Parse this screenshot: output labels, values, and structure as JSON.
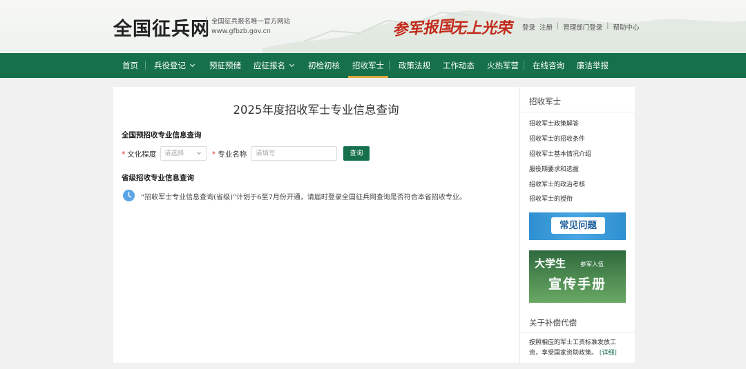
{
  "header": {
    "logo": "全国征兵网",
    "subtitle_line1": "全国征兵报名唯一官方网站",
    "subtitle_line2": "www.gfbzb.gov.cn",
    "slogan1": "参军报国",
    "slogan2": "无上光荣",
    "links": {
      "login": "登录",
      "register": "注册",
      "admin_login": "管理部门登录",
      "help": "帮助中心",
      "separator": "|"
    }
  },
  "nav": {
    "items": [
      {
        "label": "首页",
        "dropdown": false
      },
      {
        "label": "兵役登记",
        "dropdown": true
      },
      {
        "label": "预征预储",
        "dropdown": false
      },
      {
        "label": "应征报名",
        "dropdown": true
      },
      {
        "label": "初检初核",
        "dropdown": false
      },
      {
        "label": "招收军士",
        "dropdown": false,
        "active": true
      },
      {
        "label": "政策法规",
        "dropdown": false
      },
      {
        "label": "工作动态",
        "dropdown": false
      },
      {
        "label": "火热军营",
        "dropdown": false
      },
      {
        "label": "在线咨询",
        "dropdown": false
      },
      {
        "label": "廉洁举报",
        "dropdown": false
      }
    ]
  },
  "main": {
    "title": "2025年度招收军士专业信息查询",
    "national_section": "全国预招收专业信息查询",
    "required_mark": "*",
    "education_label": "文化程度",
    "education_placeholder": "请选择",
    "major_label": "专业名称",
    "major_placeholder": "请填写",
    "query_button": "查询",
    "provincial_section": "省级招收专业信息查询",
    "notice": "“招收军士专业信息查询(省级)”计划于6至7月份开通，请届时登录全国征兵网查询是否符合本省招收专业。"
  },
  "sidebar": {
    "heading": "招收军士",
    "links": [
      "招收军士政策解答",
      "招收军士的招收条件",
      "招收军士基本情况介绍",
      "服役期要求和选拔",
      "招收军士的政治考核",
      "招收军士的授衔"
    ],
    "banner1": "常见问题",
    "banner2_big": "大学生",
    "banner2_small": "参军入伍",
    "banner2_title": "宣传手册",
    "section2_heading": "关于补偿代偿",
    "section2_text": "按照相应的军士工资标准发放工资，享受国家资助政策。",
    "more_link": "[详细]"
  },
  "colors": {
    "primary_green": "#15704b",
    "accent_gold": "#e0a93b",
    "slogan_red": "#c22a1c",
    "required_red": "#d9342b",
    "notice_blue": "#5aa5e6"
  }
}
